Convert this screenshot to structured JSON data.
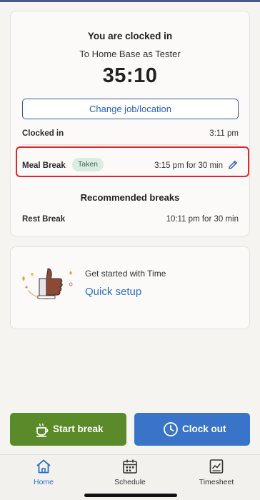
{
  "clock": {
    "title": "You are clocked in",
    "subtitle": "To Home Base as Tester",
    "timer": "35:10",
    "change_label": "Change job/location"
  },
  "clocked_in": {
    "label": "Clocked in",
    "time": "3:11 pm"
  },
  "meal_break": {
    "label": "Meal Break",
    "badge": "Taken",
    "detail": "3:15 pm for 30 min"
  },
  "recommended": {
    "title": "Recommended breaks",
    "items": [
      {
        "label": "Rest Break",
        "detail": "10:11 pm for 30 min"
      }
    ]
  },
  "setup": {
    "prefix": "Get started with Time",
    "link": "Quick setup"
  },
  "actions": {
    "start_break": "Start break",
    "clock_out": "Clock out"
  },
  "tabs": [
    {
      "label": "Home",
      "icon": "home-icon",
      "active": true
    },
    {
      "label": "Schedule",
      "icon": "calendar-icon",
      "active": false
    },
    {
      "label": "Timesheet",
      "icon": "timesheet-icon",
      "active": false
    }
  ],
  "colors": {
    "accent": "#2a6fc6",
    "start_break": "#5a8a2a",
    "clock_out": "#3a74c8",
    "highlight": "#e0272a",
    "badge_bg": "#dbece2"
  }
}
